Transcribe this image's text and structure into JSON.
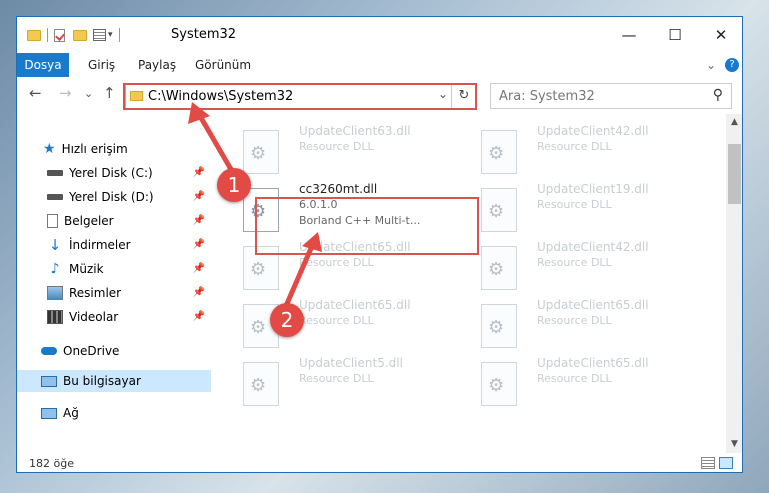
{
  "window": {
    "title": "System32",
    "qat_chevron": "▾",
    "controls": {
      "minimize": "—",
      "maximize": "☐",
      "close": "✕"
    }
  },
  "ribbon": {
    "tabs": [
      "Dosya",
      "Giriş",
      "Paylaş",
      "Görünüm"
    ],
    "collapse_glyph": "⌄",
    "help_glyph": "?"
  },
  "address_bar": {
    "back": "←",
    "forward": "→",
    "recent": "⌄",
    "up": "↑",
    "path": "C:\\Windows\\System32",
    "dropdown_glyph": "⌄",
    "refresh_glyph": "↻",
    "search_placeholder": "Ara: System32",
    "search_glyph": "⚲"
  },
  "nav": {
    "quick_access": "Hızlı erişim",
    "pinned": [
      {
        "label": "Yerel Disk (C:)",
        "icon": "drive-icon"
      },
      {
        "label": "Yerel Disk (D:)",
        "icon": "drive-icon"
      },
      {
        "label": "Belgeler",
        "icon": "documents-icon"
      },
      {
        "label": "İndirmeler",
        "icon": "downloads-icon"
      },
      {
        "label": "Müzik",
        "icon": "music-icon"
      },
      {
        "label": "Resimler",
        "icon": "pictures-icon"
      },
      {
        "label": "Videolar",
        "icon": "videos-icon"
      }
    ],
    "onedrive": "OneDrive",
    "this_pc": "Bu bilgisayar",
    "network": "Ağ",
    "pin_glyph": "📌"
  },
  "files": [
    {
      "name": "UpdateClient63.dll",
      "type": "Resource DLL"
    },
    {
      "name": "UpdateClient42.dll",
      "type": "Resource DLL"
    },
    {
      "name": "cc3260mt.dll",
      "version": "6.0.1.0",
      "desc": "Borland C++ Multi-t..."
    },
    {
      "name": "UpdateClient19.dll",
      "type": "Resource DLL"
    },
    {
      "name": "UpdateClient65.dll",
      "type": "Resource DLL"
    },
    {
      "name": "UpdateClient42.dll",
      "type": "Resource DLL"
    },
    {
      "name": "UpdateClient65.dll",
      "type": "Resource DLL"
    },
    {
      "name": "UpdateClient65.dll",
      "type": "Resource DLL"
    },
    {
      "name": "UpdateClient5.dll",
      "type": "Resource DLL"
    },
    {
      "name": "UpdateClient65.dll",
      "type": "Resource DLL"
    }
  ],
  "status": {
    "item_count": "182 öğe"
  },
  "markers": [
    "1",
    "2"
  ],
  "colors": {
    "accent": "#1979ca",
    "highlight": "#d9534f"
  }
}
